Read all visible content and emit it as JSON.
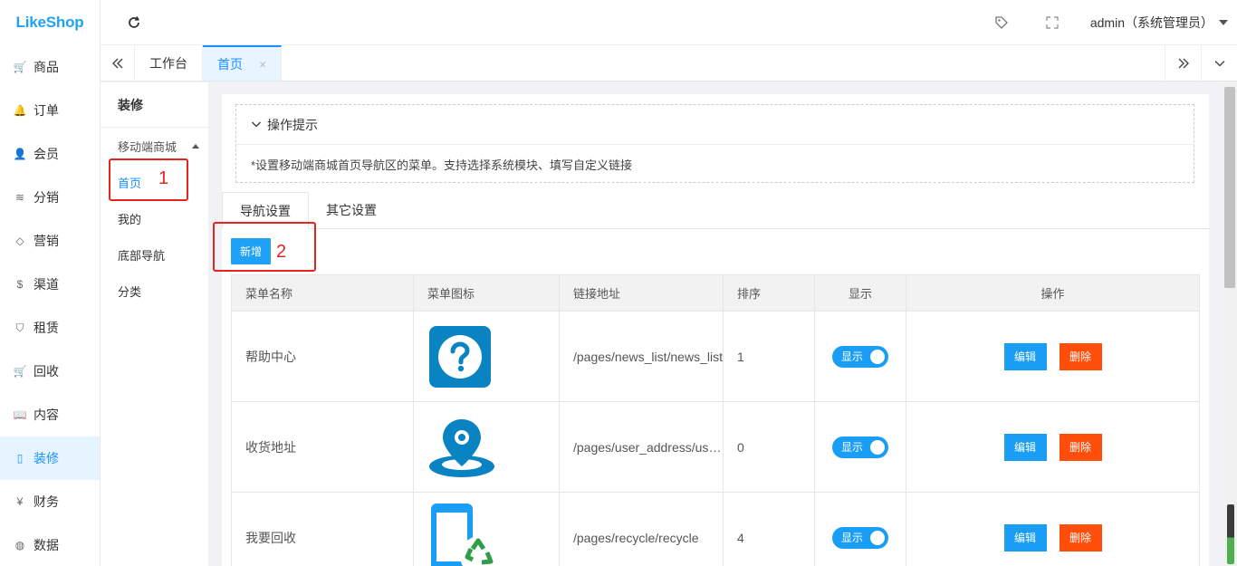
{
  "logo": "LikeShop",
  "sidebar": {
    "items": [
      {
        "label": "商品",
        "icon": "cart-icon",
        "glyph": "🛒"
      },
      {
        "label": "订单",
        "icon": "bell-icon",
        "glyph": "🔔"
      },
      {
        "label": "会员",
        "icon": "user-icon",
        "glyph": "👤"
      },
      {
        "label": "分销",
        "icon": "layers-icon",
        "glyph": "≋"
      },
      {
        "label": "营销",
        "icon": "diamond-icon",
        "glyph": "◇"
      },
      {
        "label": "渠道",
        "icon": "dollar-icon",
        "glyph": "$"
      },
      {
        "label": "租赁",
        "icon": "shield-icon",
        "glyph": "⛉"
      },
      {
        "label": "回收",
        "icon": "cart-icon",
        "glyph": "🛒"
      },
      {
        "label": "内容",
        "icon": "book-icon",
        "glyph": "📖"
      },
      {
        "label": "装修",
        "icon": "mobile-icon",
        "glyph": "▯"
      },
      {
        "label": "财务",
        "icon": "yen-icon",
        "glyph": "¥"
      },
      {
        "label": "数据",
        "icon": "globe-icon",
        "glyph": "◍"
      }
    ]
  },
  "header": {
    "user": "admin（系统管理员）"
  },
  "tabbar": {
    "tabs": [
      "工作台",
      "首页"
    ],
    "close": "×"
  },
  "submenu": {
    "title": "装修",
    "group": "移动端商城",
    "items": [
      "首页",
      "我的",
      "底部导航",
      "分类"
    ]
  },
  "tips": {
    "title": "操作提示",
    "body": "*设置移动端商城首页导航区的菜单。支持选择系统模块、填写自定义链接"
  },
  "tabs2": [
    "导航设置",
    "其它设置"
  ],
  "add_button": "新增",
  "annotations": [
    "1",
    "2"
  ],
  "table": {
    "headers": [
      "菜单名称",
      "菜单图标",
      "链接地址",
      "排序",
      "显示",
      "操作"
    ],
    "rows": [
      {
        "name": "帮助中心",
        "icon": "help-icon",
        "link": "/pages/news_list/news_list",
        "sort": "1",
        "show": "显示"
      },
      {
        "name": "收货地址",
        "icon": "location-icon",
        "link": "/pages/user_address/user_address",
        "sort": "0",
        "show": "显示"
      },
      {
        "name": "我要回收",
        "icon": "recycle-phone-icon",
        "link": "/pages/recycle/recycle",
        "sort": "4",
        "show": "显示"
      }
    ],
    "edit_label": "编辑",
    "delete_label": "删除"
  }
}
